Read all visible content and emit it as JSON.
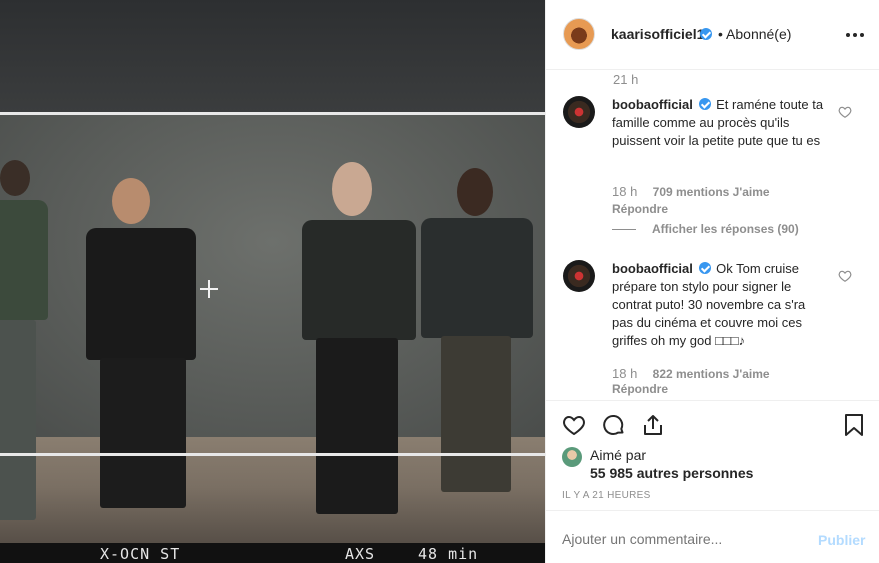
{
  "header": {
    "username": "kaarisofficiel1",
    "separator": "•",
    "follow_state": "Abonné(e)"
  },
  "comments": {
    "top_time": "21 h",
    "items": [
      {
        "username": "boobaofficial",
        "text": "Et raméne toute ta famille comme au procès qu'ils puissent voir la petite pute que tu es",
        "time": "18 h",
        "likes": "709 mentions J'aime",
        "reply": "Répondre",
        "view_replies": "Afficher les réponses (90)"
      },
      {
        "username": "boobaofficial",
        "text": "Ok Tom cruise prépare ton stylo pour signer le contrat puto! 30 novembre ca s'ra pas du cinéma et couvre moi ces griffes oh my god □□□♪",
        "time": "18 h",
        "likes": "822 mentions J'aime",
        "reply": "Répondre"
      }
    ]
  },
  "actions": {
    "liked_by_label": "Aimé par",
    "liked_by_count": "55 985 autres personnes",
    "post_time": "IL Y A 21 HEURES"
  },
  "add_comment": {
    "placeholder": "Ajouter un commentaire...",
    "post_label": "Publier"
  },
  "photo": {
    "camera_left": "X-OCN ST",
    "camera_iso": "AXS",
    "camera_time": "48 min"
  }
}
